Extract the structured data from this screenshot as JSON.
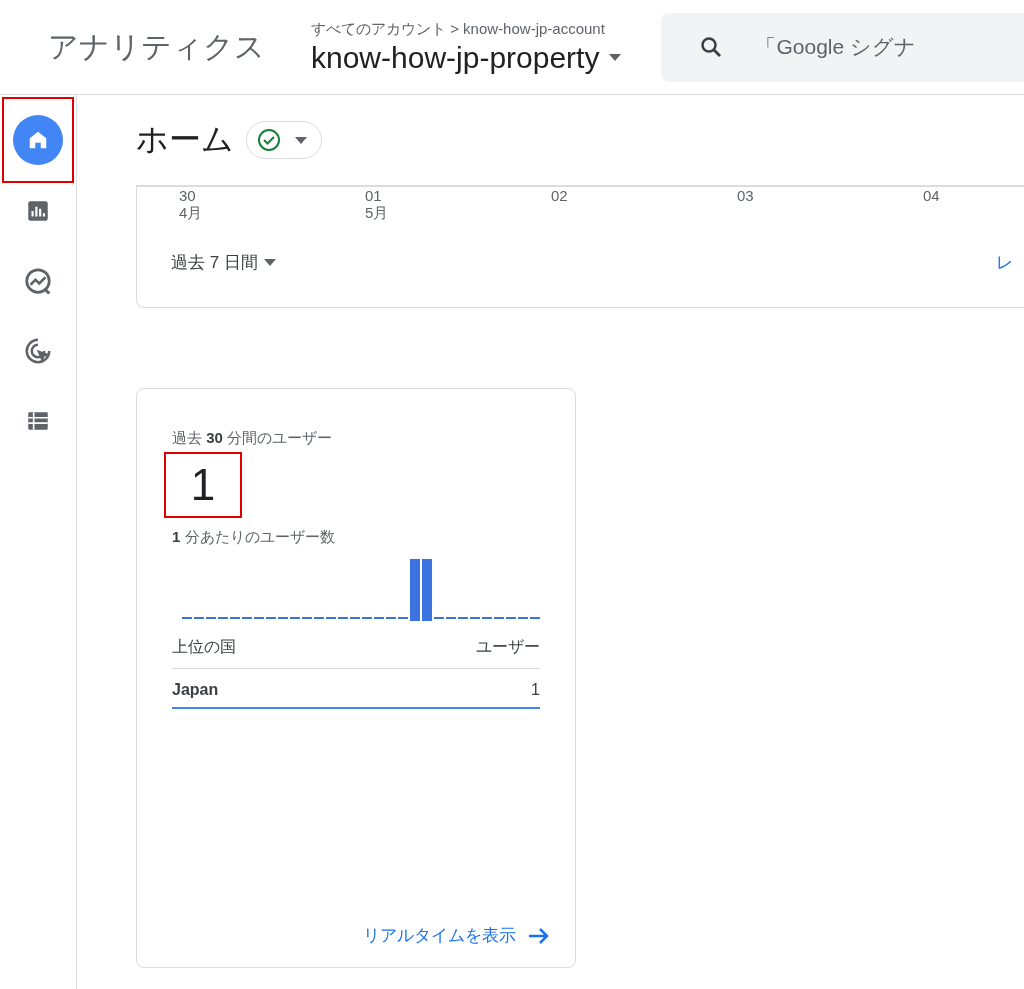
{
  "header": {
    "product": "アナリティクス",
    "breadcrumb": {
      "account": "すべてのアカウント",
      "separator": ">",
      "sub": "know-how-jp-account"
    },
    "property": "know-how-jp-property",
    "search": {
      "placeholder": "「Google シグナ"
    }
  },
  "sidebar": {
    "items": [
      {
        "kind": "home",
        "selected": true,
        "highlighted": true
      },
      {
        "kind": "reports",
        "selected": false,
        "highlighted": false
      },
      {
        "kind": "explore",
        "selected": false,
        "highlighted": false
      },
      {
        "kind": "advertising",
        "selected": false,
        "highlighted": false
      },
      {
        "kind": "configure",
        "selected": false,
        "highlighted": false
      }
    ]
  },
  "page": {
    "title": "ホーム",
    "verified": true
  },
  "overview_card": {
    "axis_labels": [
      {
        "day": "30",
        "month": "4月"
      },
      {
        "day": "01",
        "month": "5月"
      },
      {
        "day": "02"
      },
      {
        "day": "03"
      },
      {
        "day": "04"
      }
    ],
    "date_range": "過去 7 日間",
    "link": "レ"
  },
  "realtime_card": {
    "title": "過去 **30** 分間のユーザー",
    "value": "1",
    "value_highlighted": true,
    "per_minute_label": "**1** 分あたりのユーザー数",
    "table": {
      "columns": [
        "上位の国",
        "ユーザー"
      ],
      "rows": [
        {
          "country": "Japan",
          "users": "1"
        }
      ]
    },
    "link": "リアルタイムを表示"
  }
}
